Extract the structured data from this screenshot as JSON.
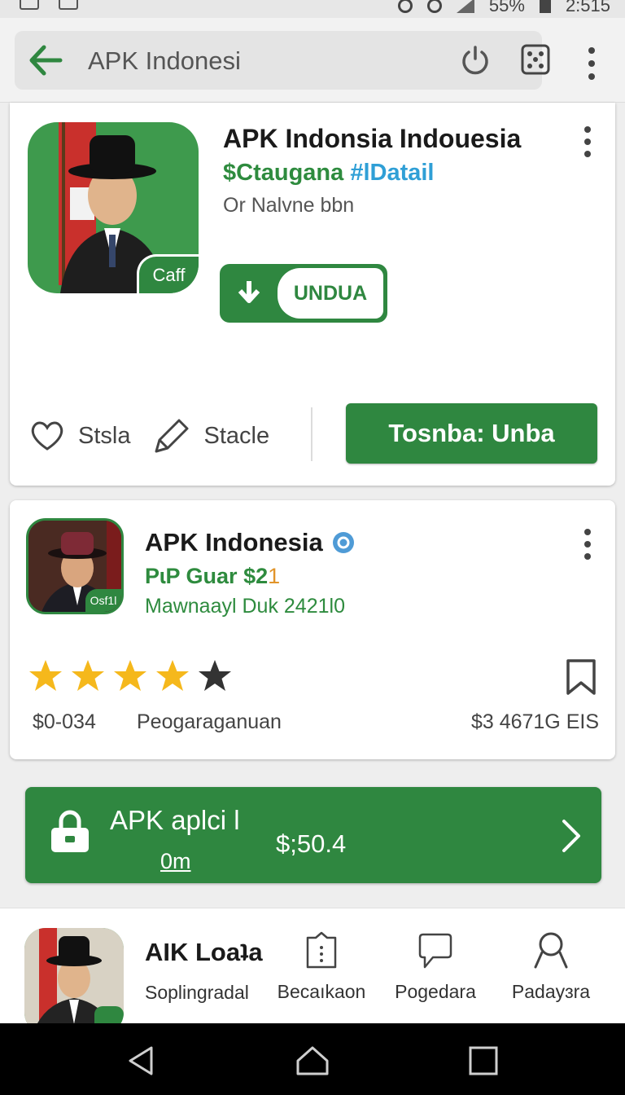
{
  "status_bar": {
    "battery": "55%",
    "time": "2:515"
  },
  "search": {
    "query": "APK Indonesi"
  },
  "card1": {
    "icon_badge": "Caff",
    "title": "APK Indonsia  Indouesia",
    "subtitle_green": "$Ctaugana",
    "subtitle_blue": "#lDatail",
    "meta": "Or Nalvne bbn",
    "download_label": "UNDUA",
    "action1": "Stsla",
    "action2": "Stacle",
    "primary_button": "Tosnba:  Unba"
  },
  "card2": {
    "icon_badge": "Osf1l",
    "title": "APK Indonesia",
    "subtitle_green": "PɩP Guar",
    "subtitle_price_green": "$2",
    "subtitle_price_orange": "1",
    "meta": "Mawnaayl Duk 2421l0",
    "rating": 4,
    "rating_max": 5,
    "footer_left": "$0-034",
    "footer_middle": "Peogaraganuan",
    "footer_right": "$3 4671G EIS"
  },
  "promo": {
    "title": "APK aplci  l",
    "subtitle": "0m",
    "price": "$;50.4"
  },
  "bottom_panel": {
    "title": "AIK Loaʇa",
    "subtitle": "Soplingradal",
    "tabs": [
      {
        "label": "Becaıkaon",
        "icon": "tag-icon"
      },
      {
        "label": "Pogedara",
        "icon": "chat-icon"
      },
      {
        "label": "Padayɜra",
        "icon": "search-icon"
      }
    ]
  },
  "colors": {
    "green": "#2f8740",
    "accent_blue": "#2f9fd6",
    "star": "#f5b81c"
  }
}
